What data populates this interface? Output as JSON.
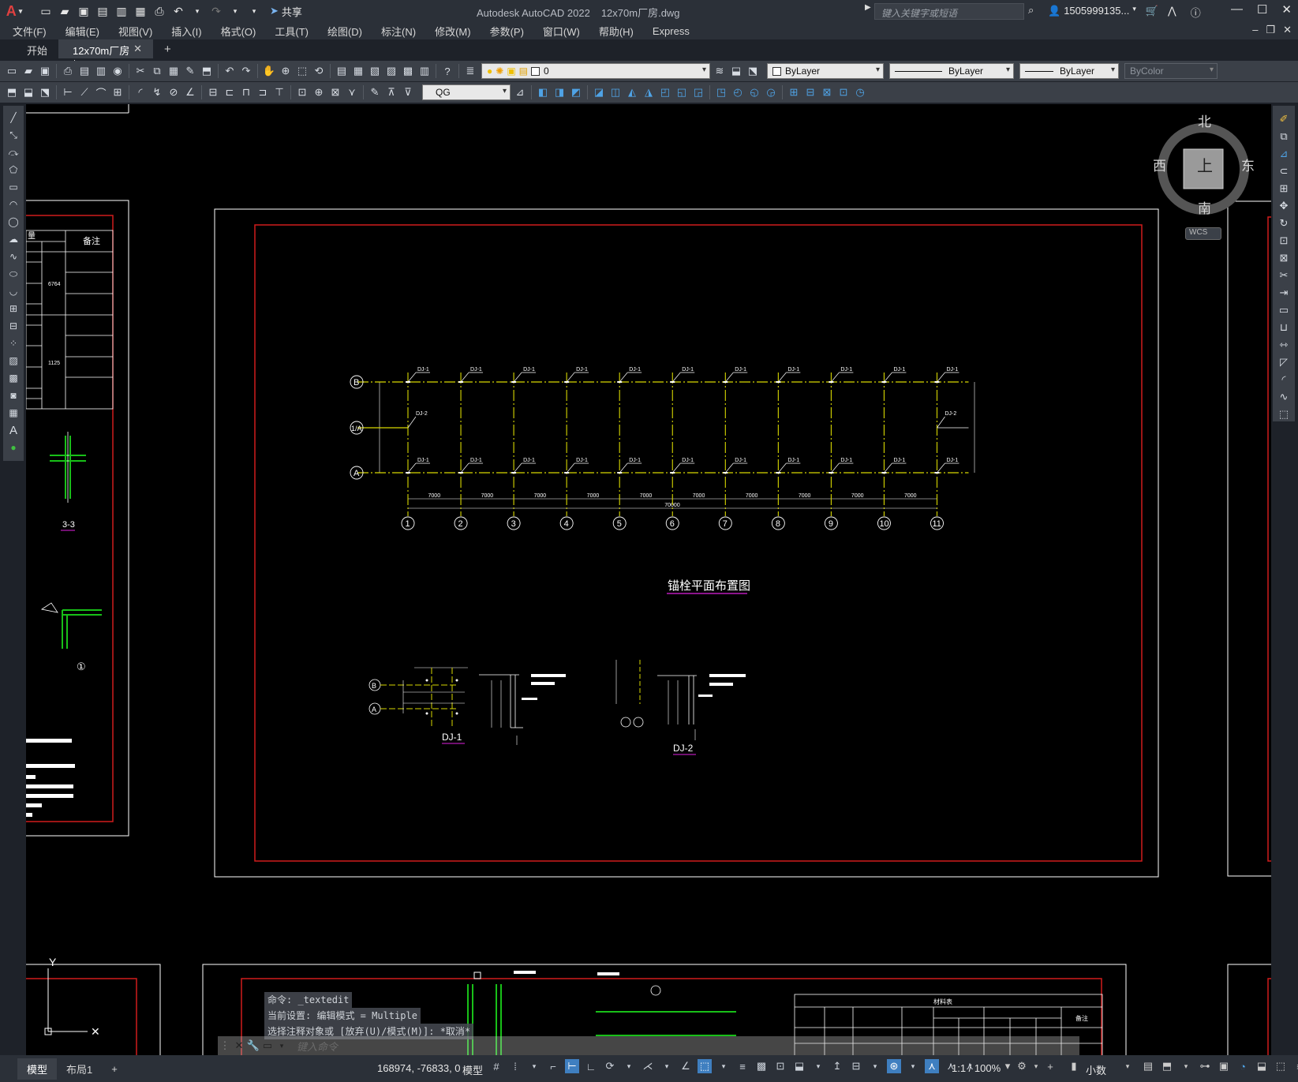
{
  "window": {
    "title": "Autodesk AutoCAD 2022",
    "file": "12x70m厂房.dwg",
    "search_placeholder": "键入关键字或短语",
    "user": "1505999135...",
    "share": "共享"
  },
  "menu": [
    "文件(F)",
    "编辑(E)",
    "视图(V)",
    "插入(I)",
    "格式(O)",
    "工具(T)",
    "绘图(D)",
    "标注(N)",
    "修改(M)",
    "参数(P)",
    "窗口(W)",
    "帮助(H)",
    "Express"
  ],
  "tabs": {
    "start": "开始",
    "active": "12x70m厂房*"
  },
  "properties": {
    "layer": "0",
    "color": "ByLayer",
    "linetype": "ByLayer",
    "lineweight": "ByLayer",
    "plotstyle": "ByColor",
    "dimstyle": "QG"
  },
  "viewcube": {
    "north": "北",
    "south": "南",
    "east": "东",
    "west": "西",
    "top": "上",
    "wcs": "WCS"
  },
  "drawing": {
    "title": "锚栓平面布置图",
    "axes_x": [
      "1",
      "2",
      "3",
      "4",
      "5",
      "6",
      "7",
      "8",
      "9",
      "10",
      "11"
    ],
    "axes_y": [
      "B",
      "1/A",
      "A"
    ],
    "bay": "7000",
    "total": "70000",
    "tag_dj1": "DJ-1",
    "tag_dj2": "DJ-2",
    "detail1": "DJ-1",
    "detail2": "DJ-2",
    "left_section": "3-3",
    "left_circle": "①",
    "left_table_header1": "量",
    "left_table_header2": "备注",
    "left_weight1": "6764",
    "left_weight2": "1125",
    "bottom_table_title": "材料表",
    "bottom_table_remark": "备注"
  },
  "command": {
    "history": [
      "命令: _textedit",
      "当前设置: 编辑模式 = Multiple",
      "选择注释对象或 [放弃(U)/模式(M)]: *取消*"
    ],
    "placeholder": "键入命令"
  },
  "status": {
    "tabs": [
      "模型",
      "布局1"
    ],
    "coords": "168974, -76833, 0",
    "space": "模型",
    "scale": "1:1 / 100%",
    "units": "小数"
  },
  "colors": {
    "accent": "#3f7fc0",
    "frame_red": "#d01c1c",
    "axis_yellow": "#d8d800",
    "dim_green": "#18c018"
  }
}
